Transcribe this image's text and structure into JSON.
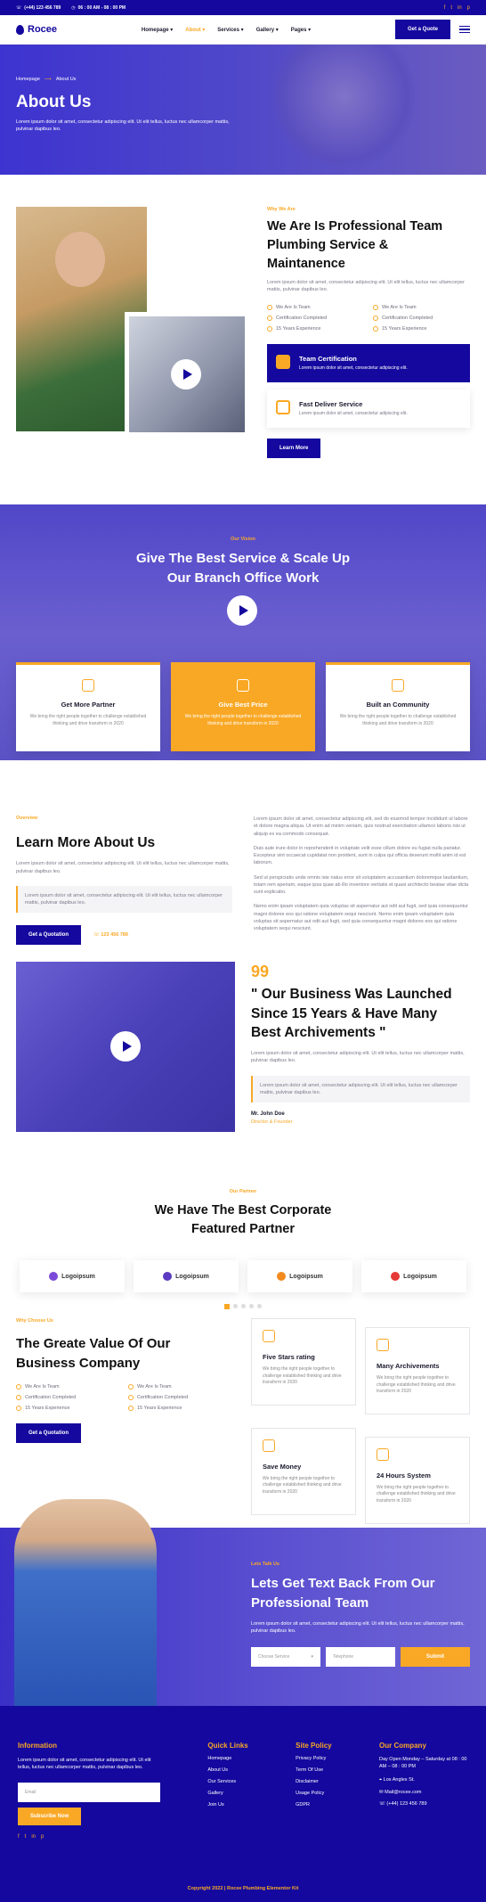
{
  "topbar": {
    "phone": "(+44) 123 456 789",
    "hours": "06 : 00 AM - 08 : 00 PM",
    "social": [
      "f",
      "t",
      "in",
      "p"
    ]
  },
  "nav": {
    "brand": "Rocee",
    "menu": [
      "Homepage",
      "About",
      "Services",
      "Gallery",
      "Pages"
    ],
    "cta": "Get a Quote"
  },
  "hero": {
    "crumb_home": "Homepage",
    "crumb_current": "About Us",
    "title": "About Us",
    "text": "Lorem ipsum dolor sit amet, consectetur adipiscing elit. Ut elit tellus, luctus nec ullamcorper mattis, pulvinar dapibus leo."
  },
  "about": {
    "kicker": "Why We Are",
    "title": "We Are Is Professional Team Plumbing Service & Maintanence",
    "text": "Lorem ipsum dolor sit amet, consectetur adipiscing elit. Ut elit tellus, luctus nec ullamcorper mattis, pulvinar dapibus leo.",
    "checks": [
      "We Are Is Team",
      "We Are Is Team",
      "Certification Completed",
      "Certification Completed",
      "15 Years Experience",
      "15 Years Experience"
    ],
    "card1_title": "Team Certification",
    "card1_text": "Lorem ipsum dolor sit amet, consectetur adipiscing elit.",
    "card2_title": "Fast Deliver Service",
    "card2_text": "Lorem ipsum dolor sit amet, consectetur adipiscing elit.",
    "button": "Learn More"
  },
  "vision": {
    "kicker": "Our Vision",
    "title": "Give The Best Service & Scale Up Our Branch Office Work"
  },
  "service_cards": [
    {
      "title": "Get More Partner",
      "text": "We bring the right people together to challenge established thinking and drive transform in 2020"
    },
    {
      "title": "Give Best Price",
      "text": "We bring the right people together to challenge established thinking and drive transform in 2020"
    },
    {
      "title": "Built an Community",
      "text": "We bring the right people together to challenge established thinking and drive transform in 2020"
    }
  ],
  "learn": {
    "kicker": "Overview",
    "title": "Learn More About Us",
    "text": "Lorem ipsum dolor sit amet, consectetur adipiscing elit. Ut elit tellus, luctus nec ullamcorper mattis, pulvinar dapibus leo.",
    "quote": "Lorem ipsum dolor sit amet, consectetur adipiscing elit. Ut elit tellus, luctus nec ullamcorper mattis, pulvinar dapibus leo.",
    "button": "Get a Quotation",
    "phone": "123 456 789",
    "paras": [
      "Lorem ipsum dolor sit amet, consectetur adipiscing elit, sed do eiusmod tempor incididunt ut labore et dolore magna aliqua. Ut enim ad minim veniam, quis nostrud exercitation ullamco laboris nisi ut aliquip ex ea commodo consequat.",
      "Duis aute irure dolor in reprehenderit in voluptate velit esse cillum dolore eu fugiat nulla pariatur. Excepteur sint occaecat cupidatat non proident, sunt in culpa qui officia deserunt mollit anim id est laborum.",
      "Sed ut perspiciatis unde omnis iste natus error sit voluptatem accusantium doloremque laudantium, totam rem aperiam, eaque ipsa quae ab illo inventore veritatis et quasi architecto beatae vitae dicta sunt explicabo.",
      "Nemo enim ipsam voluptatem quia voluptas sit aspernatur aut odit aut fugit, sed quia consequuntur magni dolores eos qui ratione voluptatem sequi nesciunt. Nemo enim ipsam voluptatem quia voluptas sit aspernatur aut odit aut fugit, sed quia consequuntur magni dolores eos qui ratione voluptatem sequi nesciunt."
    ]
  },
  "launch": {
    "quote_mark": "99",
    "title": "\" Our Business Was Launched Since 15 Years & Have Many Best Archivements \"",
    "text": "Lorem ipsum dolor sit amet, consectetur adipiscing elit. Ut elit tellus, luctus nec ullamcorper mattis, pulvinar dapibus leo.",
    "quote": "Lorem ipsum dolor sit amet, consectetur adipiscing elit. Ut elit tellus, luctus nec ullamcorper mattis, pulvinar dapibus leo.",
    "name": "Mr. John Doe",
    "role": "Director & Founder"
  },
  "partner": {
    "kicker": "Our Partner",
    "title": "We Have The Best Corporate Featured Partner",
    "logos": [
      {
        "name": "Logoipsum",
        "color": "#7b4ad8"
      },
      {
        "name": "Logoipsum",
        "color": "#5a3ac0"
      },
      {
        "name": "Logoipsum",
        "color": "#f28a1e"
      },
      {
        "name": "Logoipsum",
        "color": "#e53935"
      }
    ]
  },
  "why": {
    "kicker": "Why Choose Us",
    "title": "The Greate Value Of Our Business Company",
    "checks": [
      "We Are Is Team",
      "We Are Is Team",
      "Certification Completed",
      "Certification Completed",
      "15 Years Experience",
      "15 Years Experience"
    ],
    "button": "Get a Quotation",
    "cards": [
      {
        "title": "Five Stars rating",
        "text": "We bring the right people together to challenge established thinking and drive transform in 2020"
      },
      {
        "title": "Many Archivements",
        "text": "We bring the right people together to challenge established thinking and drive transform in 2020"
      },
      {
        "title": "Save Money",
        "text": "We bring the right people together to challenge established thinking and drive transform in 2020"
      },
      {
        "title": "24 Hours System",
        "text": "We bring the right people together to challenge established thinking and drive transform in 2020"
      }
    ]
  },
  "contact": {
    "kicker": "Lets Talk Us",
    "title": "Lets Get Text Back From Our Professional Team",
    "text": "Lorem ipsum dolor sit amet, consectetur adipiscing elit. Ut elit tellus, luctus nec ullamcorper mattis, pulvinar dapibus leo.",
    "select_placeholder": "Choose Service",
    "phone_placeholder": "Telephone",
    "submit": "Submit"
  },
  "footer": {
    "info_title": "Information",
    "info_text": "Lorem ipsum dolor sit amet, consectetur adipiscing elit. Ut elit tellus, luctus nec ullamcorper mattis, pulvinar dapibus leo.",
    "email_placeholder": "Email",
    "subscribe": "Subscribe Now",
    "links_title": "Quick Links",
    "links": [
      "Homepage",
      "About Us",
      "Our Services",
      "Gallery",
      "Join Us"
    ],
    "policy_title": "Site Policy",
    "policy": [
      "Privacy Policy",
      "Term Of Use",
      "Disclaimer",
      "Usage Policy",
      "GDPR"
    ],
    "company_title": "Our Company",
    "company_hours": "Day Open Monday – Saturday at 08 : 00 AM – 08 : 00 PM",
    "company": [
      "Los Angles St.",
      "Mail@rocee.com",
      "(+44) 123 456 789"
    ],
    "copyright": "Copyright 2022 | Rocee Plumbing Elementor Kit"
  },
  "colors": {
    "navy": "#14089e",
    "orange": "#f9a825"
  }
}
